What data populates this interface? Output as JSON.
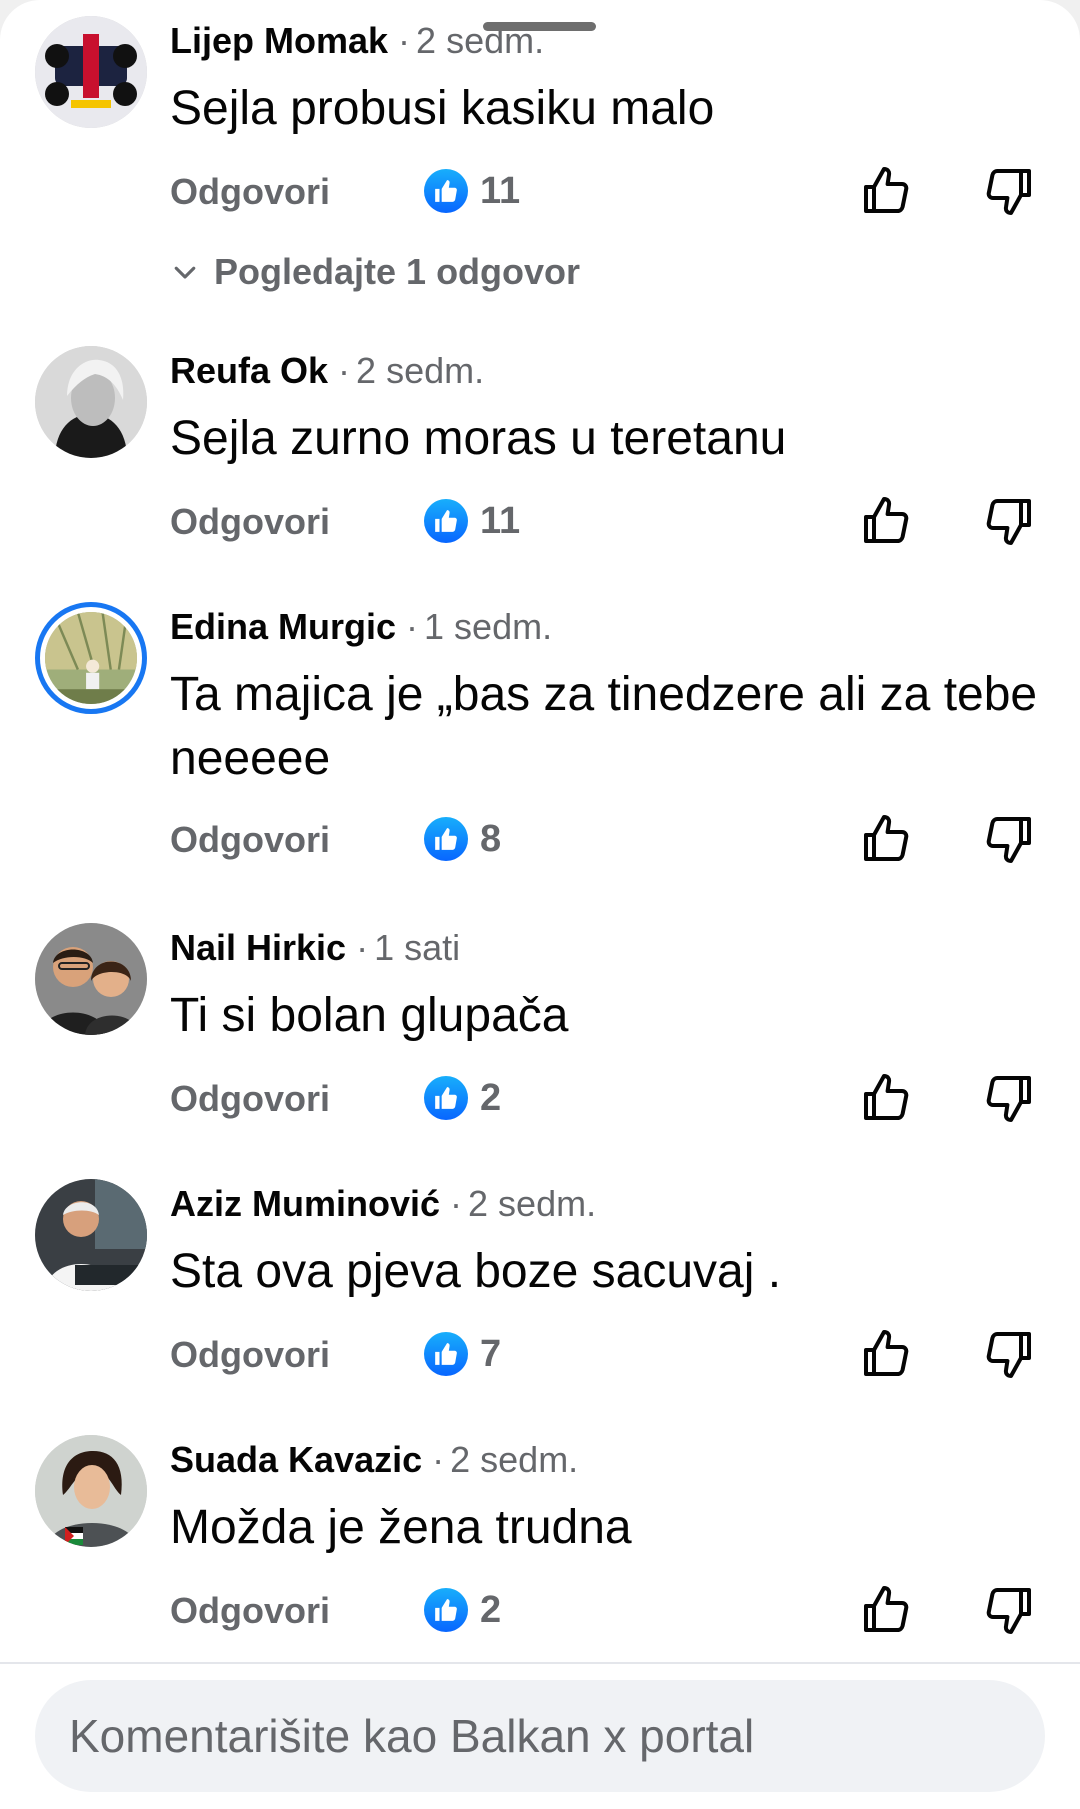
{
  "comments": [
    {
      "author": "Lijep Momak",
      "time": "2 sedm.",
      "text": "Sejla probusi kasiku malo",
      "reply_label": "Odgovori",
      "likes": "11",
      "view_replies": "Pogledajte 1 odgovor"
    },
    {
      "author": "Reufa Ok",
      "time": "2 sedm.",
      "text": "Sejla zurno moras u teretanu",
      "reply_label": "Odgovori",
      "likes": "11"
    },
    {
      "author": "Edina Murgic",
      "time": "1 sedm.",
      "text": "Ta majica je „bas za tinedzere ali za tebe neeeee",
      "reply_label": "Odgovori",
      "likes": "8"
    },
    {
      "author": "Nail Hirkic",
      "time": "1 sati",
      "text": "Ti si bolan glupača",
      "reply_label": "Odgovori",
      "likes": "2"
    },
    {
      "author": "Aziz Muminović",
      "time": "2 sedm.",
      "text": "Sta ova pjeva boze sacuvaj .",
      "reply_label": "Odgovori",
      "likes": "7"
    },
    {
      "author": "Suada Kavazic",
      "time": "2 sedm.",
      "text": "Možda je žena trudna",
      "reply_label": "Odgovori",
      "likes": "2"
    }
  ],
  "composer": {
    "placeholder": "Komentarišite kao Balkan x portal"
  },
  "colors": {
    "accent": "#1877f2",
    "like_badge": "#0866ff",
    "secondary_text": "#65676b",
    "primary_text": "#050505"
  },
  "icons": {
    "like_badge": "like-thumb-icon",
    "vote_up": "thumbs-up-outline-icon",
    "vote_down": "thumbs-down-outline-icon",
    "expand": "chevron-down-icon"
  }
}
